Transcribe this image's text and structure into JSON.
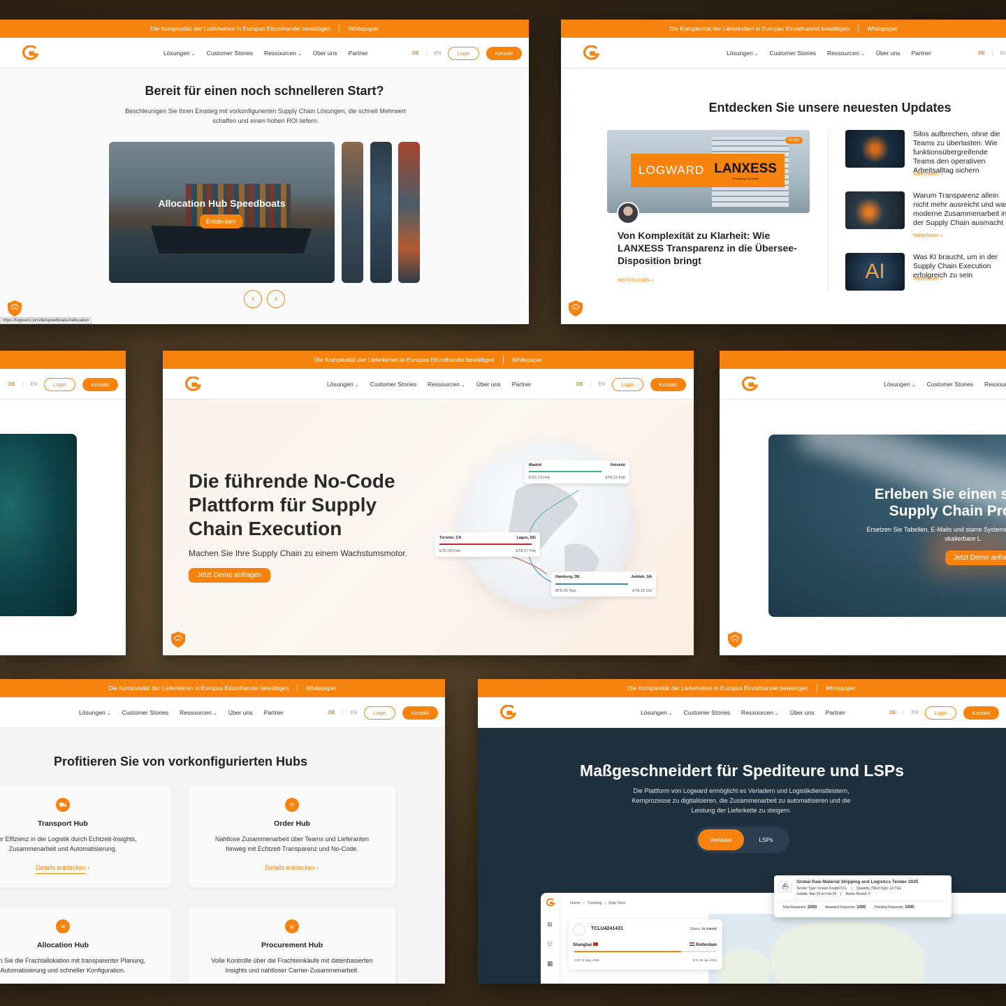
{
  "common": {
    "promo": "Die Komplexität der Lieferketten in Europas Einzelhandel bewältigen",
    "promo_link": "Whitepaper",
    "nav": {
      "loesungen": "Lösungen",
      "stories": "Customer Stories",
      "ressourcen": "Ressourcen",
      "ueber": "Über uns",
      "partner": "Partner"
    },
    "lang_de": "DE",
    "lang_sep": "|",
    "lang_en": "EN",
    "login": "Login",
    "kontakt": "Kontakt"
  },
  "panel1": {
    "heading": "Bereit für einen noch schnelleren Start?",
    "sub": "Beschleunigen Sie Ihren Einstieg mit vorkonfigurierten Supply Chain Lösungen, die schnell Mehrwert schaffen und einen hohen ROI liefern.",
    "slide_title": "Allocation Hub Speedboats",
    "slide_button": "Entdecken",
    "prev": "‹",
    "next": "›",
    "status_url": "https://logward.com/de/speedboats/#allocation"
  },
  "panel2": {
    "heading": "Entdecken Sie unsere neuesten Updates",
    "badge": "BLOG",
    "logo_left": "LOGWARD",
    "logo_right": "LANXESS",
    "logo_tag": "Energizing Chemistry",
    "feature_title": "Von Komplexität zu Klarheit: Wie LANXESS Transparenz in die Übersee-Disposition bringt",
    "feature_link": "WEITERLESEN »",
    "articles": [
      {
        "title": "Silos aufbrechen, ohne die Teams zu überlasten: Wie funktionsübergreifende Teams den operativen Arbeitsalltag sichern",
        "link": "Weiterlesen »"
      },
      {
        "title": "Warum Transparenz allein nicht mehr ausreicht und was moderne Zusammenarbeit in der Supply Chain ausmacht",
        "link": "Weiterlesen »"
      },
      {
        "title": "Was KI braucht, um in der Supply Chain Execution erfolgreich zu sein",
        "link": "Weiterlesen »",
        "thumb_text": "AI"
      }
    ]
  },
  "panel4": {
    "heading": "Die führende No-Code Plattform für Supply Chain Execution",
    "sub": "Machen Sie Ihre Supply Chain zu einem Wachstumsmotor.",
    "button": "Jetzt Demo anfragen",
    "cards": [
      {
        "from": "Madrid",
        "to": "Helsinki",
        "etd": "ETD 12 Feb",
        "eta": "ETA 21 Feb"
      },
      {
        "from": "Toronto, CA",
        "to": "Lagos, NG",
        "etd": "ETD 26 Feb",
        "eta": "ETA 27 Feb"
      },
      {
        "from": "Hamburg, DE",
        "to": "Jeddah, SA",
        "etd": "ATD 01 Sep",
        "eta": "ETA 19 Oct"
      }
    ]
  },
  "panel5": {
    "heading": "Erleben Sie einen smarten Supply Chain Prozess",
    "sub": "Ersetzen Sie Tabellen, E-Mails und starre Systeme für durchgängige, skalierbare L",
    "button": "Jetzt Demo anfragen"
  },
  "panel6": {
    "heading": "Profitieren Sie von vorkonfigurierten Hubs",
    "hubs": [
      {
        "title": "Transport Hub",
        "desc": "Mehr Effizienz in der Logistik durch Echtzeit-Insights, Zusammenarbeit und Automatisierung.",
        "link": "Details entdecken"
      },
      {
        "title": "Order Hub",
        "desc": "Nahtlose Zusammenarbeit über Teams und Lieferanten hinweg mit Echtzeit-Transparenz und No-Code.",
        "link": "Details entdecken"
      },
      {
        "title": "Allocation Hub",
        "desc": "Steuern Sie die Frachtallokation mit transparenter Planung, Automatisierung und schneller Konfiguration.",
        "link": ""
      },
      {
        "title": "Procurement Hub",
        "desc": "Volle Kontrolle über die Frachteinkäufe mit datenbasierten Insights und nahtloser Carrier-Zusammenarbeit.",
        "link": ""
      }
    ]
  },
  "panel7": {
    "heading": "Maßgeschneidert für Spediteure und LSPs",
    "sub": "Die Plattform von Logward ermöglicht es Verladern und Logistikdienstleistern, Kernprozesse zu digitalisieren, die Zusammenarbeit zu automatisieren und die Leistung der Lieferkette zu steigern.",
    "toggle": [
      "Verlader",
      "LSPs"
    ],
    "breadcrumb": [
      "Home",
      "Tracking",
      "Map View"
    ],
    "container": "TCLU4241431",
    "status_label": "Status:",
    "status": "In transit",
    "from": "Shanghai",
    "to": "Rotterdam",
    "atd": "ATD 11 May 2025",
    "eta": "ETA 28 Jun 2025",
    "tender": {
      "title": "Global Raw Material Shipping and Logistics Tender 2025",
      "type": "Tender Type: Ocean Freight FCL",
      "qty": "Quantity (TEU/ Kgs): 10 TEU",
      "validity": "Validity: Mar-25 to Feb-26",
      "round": "Active Round: 5",
      "total_l": "Total Requests:",
      "total": "2000",
      "awarded_l": "Awarded Requests:",
      "awarded": "1000",
      "pending_l": "Pending Requests:",
      "pending": "1000"
    }
  },
  "colors": {
    "brand": "#f7830f",
    "navy": "#1e2f3d"
  }
}
